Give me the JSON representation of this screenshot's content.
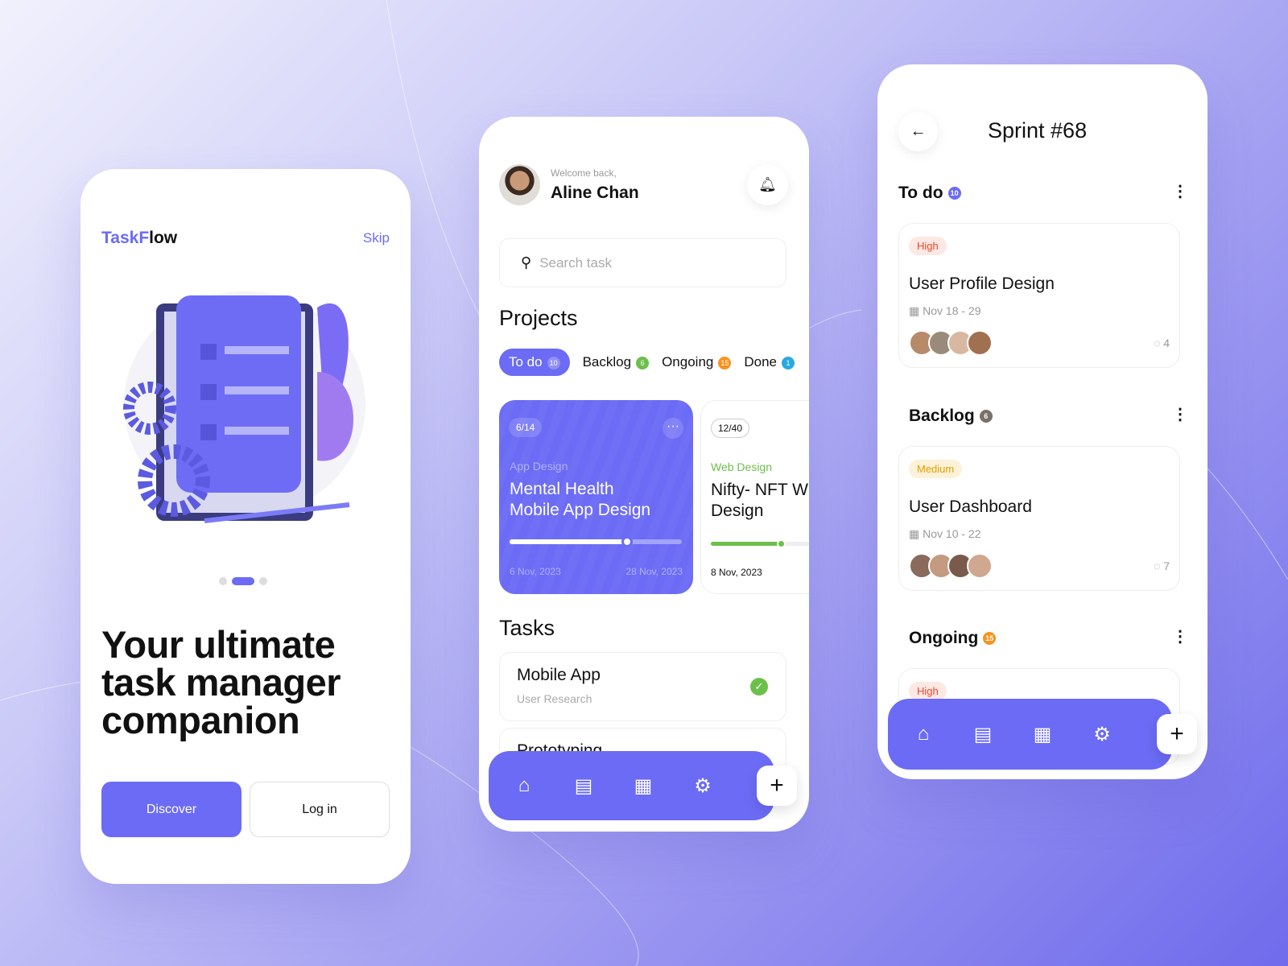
{
  "colors": {
    "accent": "#6b6bf5",
    "green": "#6cc04a",
    "orange": "#f7931e",
    "high": "#e8492b",
    "medium": "#e0a100"
  },
  "onboarding": {
    "logo_a": "Task",
    "logo_b": "F",
    "logo_c": "low",
    "skip": "Skip",
    "headline_1": "Your ultimate",
    "headline_2": "task manager",
    "headline_3": "companion",
    "discover": "Discover",
    "login": "Log in",
    "page_index": 2,
    "page_count": 3
  },
  "home": {
    "welcome": "Welcome back,",
    "name": "Aline Chan",
    "search_placeholder": "Search task",
    "projects_title": "Projects",
    "tabs": [
      {
        "label": "To do",
        "count": "10"
      },
      {
        "label": "Backlog",
        "count": "6"
      },
      {
        "label": "Ongoing",
        "count": "15"
      },
      {
        "label": "Done",
        "count": "1"
      }
    ],
    "projects": [
      {
        "count": "6/14",
        "category": "App Design",
        "title_1": "Mental Health",
        "title_2": "Mobile App Design",
        "progress": 0.68,
        "start": "6 Nov, 2023",
        "end": "28 Nov, 2023"
      },
      {
        "count": "12/40",
        "category": "Web Design",
        "title_1": "Nifty- NFT W",
        "title_2": "Design",
        "progress": 0.72,
        "start": "8 Nov, 2023"
      }
    ],
    "tasks_title": "Tasks",
    "tasks": [
      {
        "title": "Mobile App",
        "subtitle": "User Research",
        "done": true
      },
      {
        "title": "Prototyping"
      }
    ],
    "nav": [
      "home-icon",
      "document-icon",
      "calendar-icon",
      "settings-icon"
    ],
    "add": "+"
  },
  "sprint": {
    "back": "←",
    "title": "Sprint #68",
    "sections": [
      {
        "label": "To do",
        "count": "10",
        "card": {
          "priority": "High",
          "title": "User Profile Design",
          "date": "Nov 18 - 29",
          "comments": "4"
        }
      },
      {
        "label": "Backlog",
        "count": "6",
        "card": {
          "priority": "Medium",
          "title": "User Dashboard",
          "date": "Nov 10 - 22",
          "comments": "7"
        }
      },
      {
        "label": "Ongoing",
        "count": "15",
        "card": {
          "priority": "High"
        }
      }
    ],
    "add": "+"
  }
}
